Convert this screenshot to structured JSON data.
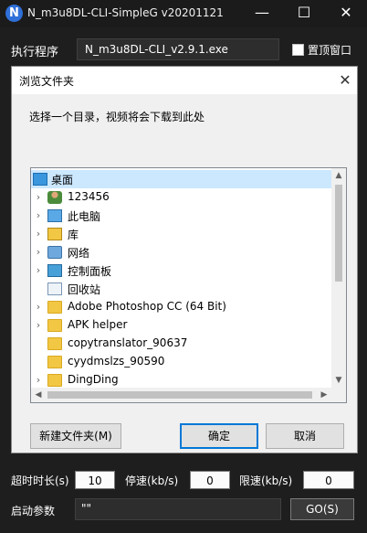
{
  "window": {
    "title": "N_m3u8DL-CLI-SimpleG v20201121",
    "app_icon_glyph": "N",
    "minimize_glyph": "—",
    "maximize_glyph": "☐",
    "close_glyph": "✕"
  },
  "main": {
    "exec_label": "执行程序",
    "exec_value": "N_m3u8DL-CLI_v2.9.1.exe",
    "topmost_label": "置顶窗口",
    "topmost_checked": false
  },
  "bottom": {
    "timeout_label": "超时时长(s)",
    "timeout_value": "10",
    "stop_speed_label": "停速(kb/s)",
    "stop_speed_value": "0",
    "limit_speed_label": "限速(kb/s)",
    "limit_speed_value": "0",
    "args_label": "启动参数",
    "args_value": "\"\"",
    "go_label": "GO(S)"
  },
  "dialog": {
    "title": "浏览文件夹",
    "close_glyph": "✕",
    "instruction": "选择一个目录，视频将会下载到此处",
    "tree": [
      {
        "label": "桌面",
        "icon": "desktop-icon",
        "expandable": false,
        "selected": true
      },
      {
        "label": "123456",
        "icon": "user-icon",
        "expandable": true,
        "selected": false
      },
      {
        "label": "此电脑",
        "icon": "computer-icon",
        "expandable": true,
        "selected": false
      },
      {
        "label": "库",
        "icon": "library-icon",
        "expandable": true,
        "selected": false
      },
      {
        "label": "网络",
        "icon": "network-icon",
        "expandable": true,
        "selected": false
      },
      {
        "label": "控制面板",
        "icon": "control-panel-icon",
        "expandable": true,
        "selected": false
      },
      {
        "label": "回收站",
        "icon": "recycle-bin-icon",
        "expandable": false,
        "selected": false
      },
      {
        "label": "Adobe Photoshop CC (64 Bit)",
        "icon": "folder-icon",
        "expandable": true,
        "selected": false
      },
      {
        "label": "APK helper",
        "icon": "folder-icon",
        "expandable": true,
        "selected": false
      },
      {
        "label": "copytranslator_90637",
        "icon": "folder-icon",
        "expandable": false,
        "selected": false
      },
      {
        "label": "cyydmslzs_90590",
        "icon": "folder-icon",
        "expandable": false,
        "selected": false
      },
      {
        "label": "DingDing",
        "icon": "folder-icon",
        "expandable": true,
        "selected": false
      }
    ],
    "new_folder_label": "新建文件夹(M)",
    "ok_label": "确定",
    "cancel_label": "取消"
  },
  "colors": {
    "selection": "#cce8ff",
    "accent": "#0078d7",
    "app_icon": "#2f6fd8",
    "dark_bg": "#1e1e1e"
  }
}
